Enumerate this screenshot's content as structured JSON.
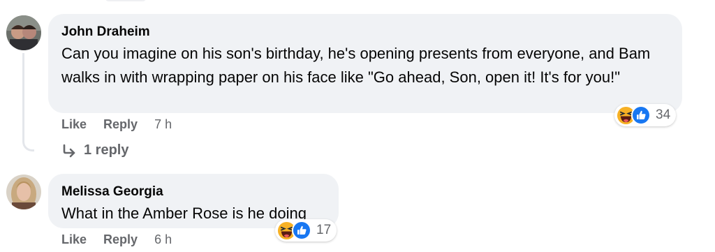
{
  "comments": [
    {
      "author": "John Draheim",
      "text": "Can you imagine on his son's birthday, he's opening presents from everyone, and Bam walks in with wrapping paper on his face like \"Go ahead, Son, open it! It's for you!\"",
      "reaction_icons": [
        "haha-icon",
        "like-icon"
      ],
      "reaction_count": "34",
      "actions": {
        "like": "Like",
        "reply": "Reply",
        "time": "7 h"
      },
      "replies_label": "1 reply"
    },
    {
      "author": "Melissa Georgia",
      "text": "What in the Amber Rose is he doing",
      "reaction_icons": [
        "haha-icon",
        "like-icon"
      ],
      "reaction_count": "17",
      "actions": {
        "like": "Like",
        "reply": "Reply",
        "time": "6 h"
      }
    }
  ],
  "colors": {
    "bubble": "#f0f2f5",
    "text": "#050505",
    "secondary": "#65676b",
    "like_blue": "#1877f2",
    "haha_yellow": "#f7b125"
  }
}
